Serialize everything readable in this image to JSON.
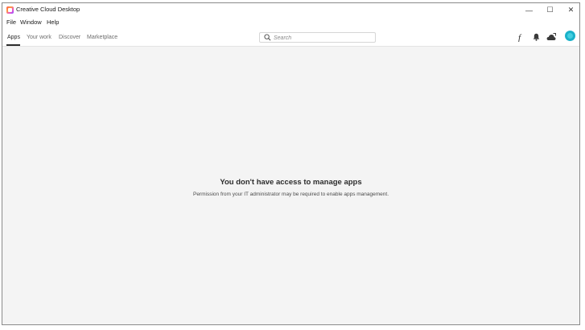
{
  "window": {
    "title": "Creative Cloud Desktop",
    "controls": {
      "minimize": "—",
      "maximize": "☐",
      "close": "✕"
    }
  },
  "menu": {
    "items": [
      "File",
      "Window",
      "Help"
    ]
  },
  "nav": {
    "tabs": [
      {
        "label": "Apps",
        "active": true
      },
      {
        "label": "Your work",
        "active": false
      },
      {
        "label": "Discover",
        "active": false
      },
      {
        "label": "Marketplace",
        "active": false
      }
    ],
    "search_placeholder": "Search",
    "icons": [
      "fonts-icon",
      "bell-icon",
      "cloud-activity-icon",
      "avatar"
    ]
  },
  "main": {
    "title": "You don't have access to manage apps",
    "description": "Permission from your IT administrator may be required to enable apps management."
  },
  "colors": {
    "background": "#f4f4f4",
    "avatar": "#1ab1c9",
    "text": "#2c2c2c"
  }
}
